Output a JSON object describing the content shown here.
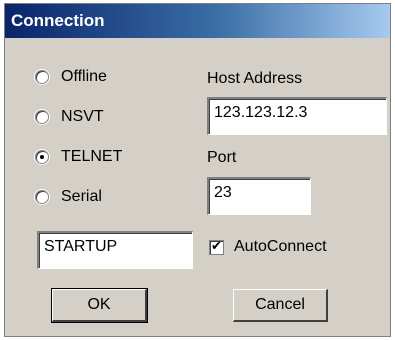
{
  "dialog": {
    "title": "Connection"
  },
  "connection_type": {
    "options": [
      {
        "label": "Offline",
        "selected": false
      },
      {
        "label": "NSVT",
        "selected": false
      },
      {
        "label": "TELNET",
        "selected": true
      },
      {
        "label": "Serial",
        "selected": false
      }
    ]
  },
  "host": {
    "label": "Host Address",
    "value": "123.123.12.3"
  },
  "port": {
    "label": "Port",
    "value": "23"
  },
  "startup": {
    "value": "STARTUP"
  },
  "autoconnect": {
    "label": "AutoConnect",
    "checked": true
  },
  "buttons": {
    "ok": "OK",
    "cancel": "Cancel"
  },
  "icons": {
    "checkmark": "✔"
  }
}
